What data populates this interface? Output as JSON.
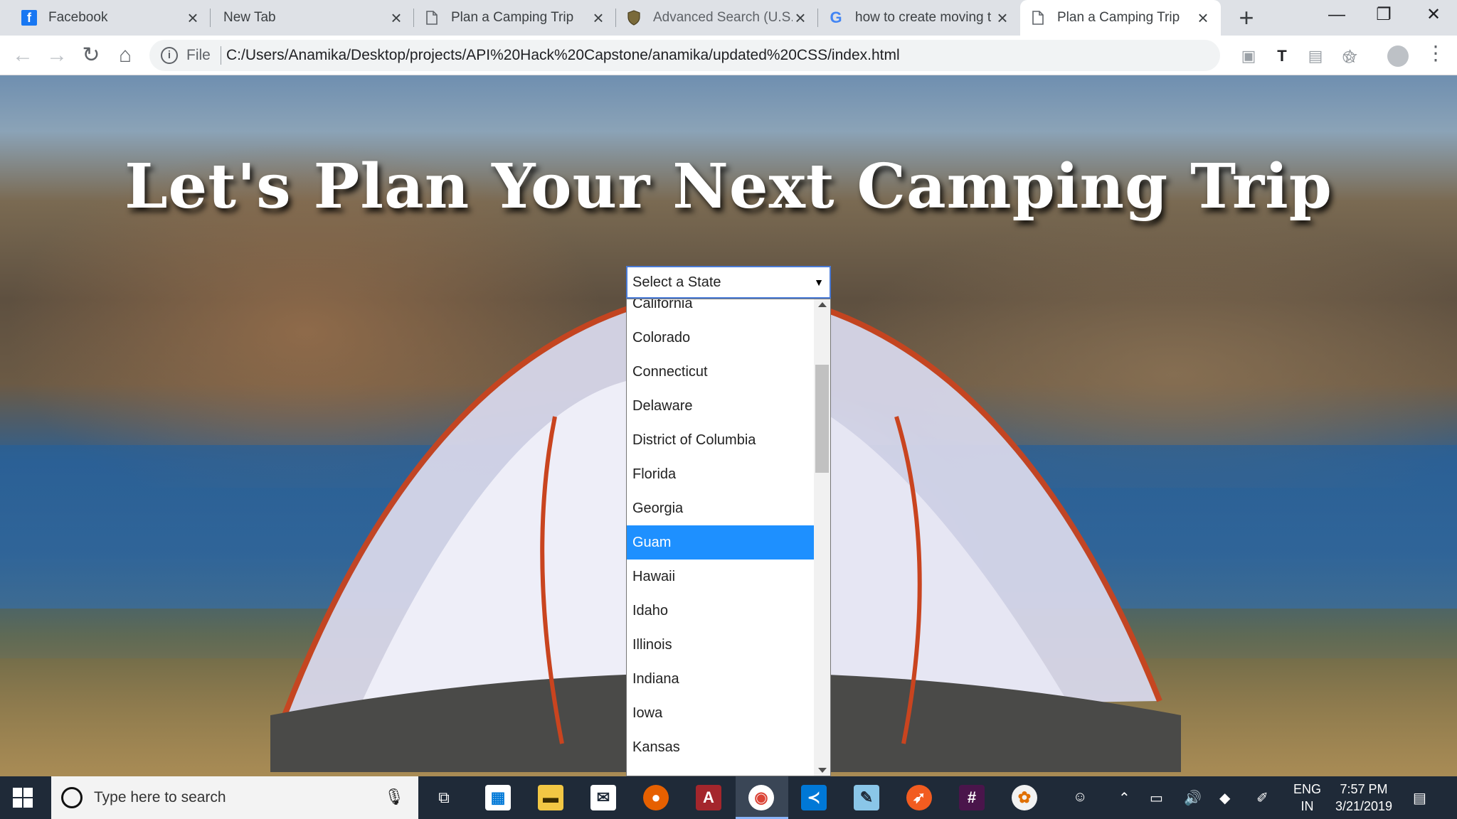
{
  "tabs": [
    {
      "title": "Facebook",
      "favicon": "facebook-icon",
      "active": false
    },
    {
      "title": "New Tab",
      "favicon": "",
      "active": false
    },
    {
      "title": "Plan a Camping Trip",
      "favicon": "page-icon",
      "active": false
    },
    {
      "title": "Advanced Search (U.S. N",
      "favicon": "shield-icon",
      "active": false
    },
    {
      "title": "how to create moving t",
      "favicon": "google-icon",
      "active": false
    },
    {
      "title": "Plan a Camping Trip",
      "favicon": "page-icon",
      "active": true
    }
  ],
  "address_bar": {
    "scheme_label": "File",
    "url": "C:/Users/Anamika/Desktop/projects/API%20Hack%20Capstone/anamika/updated%20CSS/index.html"
  },
  "page": {
    "headline": "Let's Plan Your Next Camping Trip",
    "select": {
      "placeholder": "Select a State",
      "options": [
        "California",
        "Colorado",
        "Connecticut",
        "Delaware",
        "District of Columbia",
        "Florida",
        "Georgia",
        "Guam",
        "Hawaii",
        "Idaho",
        "Illinois",
        "Indiana",
        "Iowa",
        "Kansas"
      ],
      "highlighted": "Guam"
    }
  },
  "taskbar": {
    "search_placeholder": "Type here to search",
    "lang_top": "ENG",
    "lang_bottom": "IN",
    "time": "7:57 PM",
    "date": "3/21/2019"
  },
  "colors": {
    "highlight": "#1e90ff",
    "select_border": "#4a7bd6",
    "taskbar": "#1f2a38"
  }
}
